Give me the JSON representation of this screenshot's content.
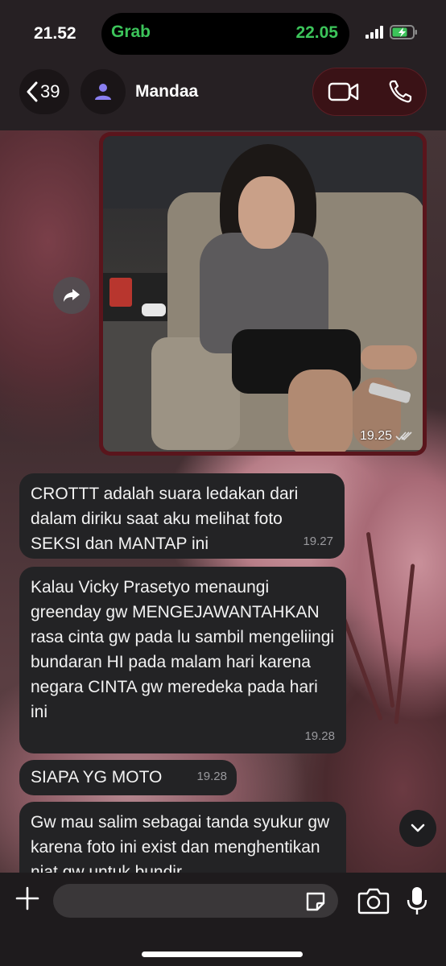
{
  "status_bar": {
    "time": "21.52",
    "live_activity": {
      "app_logo": "Grab",
      "time": "22.05"
    },
    "icons": [
      "cellular-signal-icon",
      "battery-charging-icon"
    ]
  },
  "header": {
    "back_count": "39",
    "contact_name": "Mandaa",
    "icons": [
      "chevron-left-icon",
      "person-icon",
      "video-call-icon",
      "voice-call-icon"
    ]
  },
  "colors": {
    "outgoing_bubble": "#5a151c",
    "incoming_bubble": "#232325",
    "live_activity_green": "#3cc45a"
  },
  "messages": [
    {
      "type": "image",
      "direction": "outgoing",
      "time": "19.25",
      "status": "read"
    },
    {
      "type": "text",
      "direction": "incoming",
      "text": "CROTTT adalah suara ledakan dari dalam diriku saat aku melihat foto SEKSI dan MANTAP ini",
      "time": "19.27"
    },
    {
      "type": "text",
      "direction": "incoming",
      "text": "Kalau Vicky Prasetyo menaungi greenday gw MENGEJAWANTAHKAN rasa cinta gw pada lu sambil mengeliingi bundaran HI pada malam hari karena negara CINTA gw meredeka pada hari ini",
      "time": "19.28"
    },
    {
      "type": "text",
      "direction": "incoming",
      "text": "SIAPA YG MOTO",
      "time": "19.28"
    },
    {
      "type": "text",
      "direction": "incoming",
      "text": "Gw mau salim sebagai tanda syukur gw karena foto ini exist dan menghentikan niat gw untuk bundir",
      "time": ""
    }
  ],
  "input_bar": {
    "placeholder": "",
    "icons": [
      "plus-icon",
      "sticker-icon",
      "camera-icon",
      "microphone-icon"
    ]
  }
}
